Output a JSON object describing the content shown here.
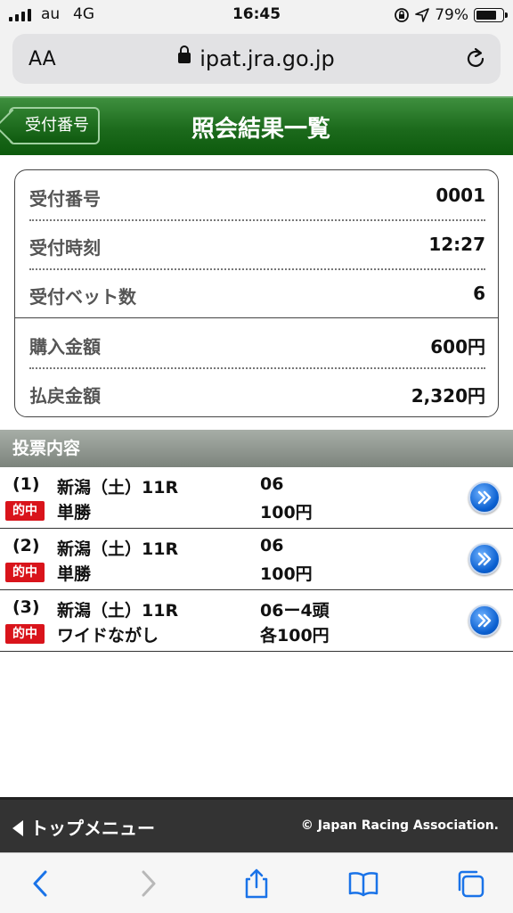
{
  "status_bar": {
    "carrier": "au",
    "network": "4G",
    "time": "16:45",
    "battery": "79%",
    "battery_level": 0.79
  },
  "browser": {
    "aa_label": "AA",
    "host": "ipat.jra.go.jp"
  },
  "header": {
    "back_label": "受付番号",
    "title": "照会結果一覧"
  },
  "summary": {
    "rows": [
      {
        "label": "受付番号",
        "value": "0001"
      },
      {
        "label": "受付時刻",
        "value": "12:27"
      },
      {
        "label": "受付ベット数",
        "value": "6"
      },
      {
        "label": "購入金額",
        "value": "600円"
      },
      {
        "label": "払戻金額",
        "value": "2,320円"
      }
    ]
  },
  "bets": {
    "section_title": "投票内容",
    "items": [
      {
        "no": "(1)",
        "race": "新潟（土）11R",
        "horse": "06",
        "badge": "的中",
        "type": "単勝",
        "amount": "100円"
      },
      {
        "no": "(2)",
        "race": "新潟（土）11R",
        "horse": "06",
        "badge": "的中",
        "type": "単勝",
        "amount": "100円"
      },
      {
        "no": "(3)",
        "race": "新潟（土）11R",
        "horse": "06ー4頭",
        "badge": "的中",
        "type": "ワイドながし",
        "amount": "各100円"
      }
    ]
  },
  "footer": {
    "top_menu": "トップメニュー",
    "copyright": "© Japan Racing Association."
  },
  "colors": {
    "header_green": "#1c6a1c",
    "hit_badge_red": "#d9141b",
    "safari_blue": "#1a73e8"
  }
}
